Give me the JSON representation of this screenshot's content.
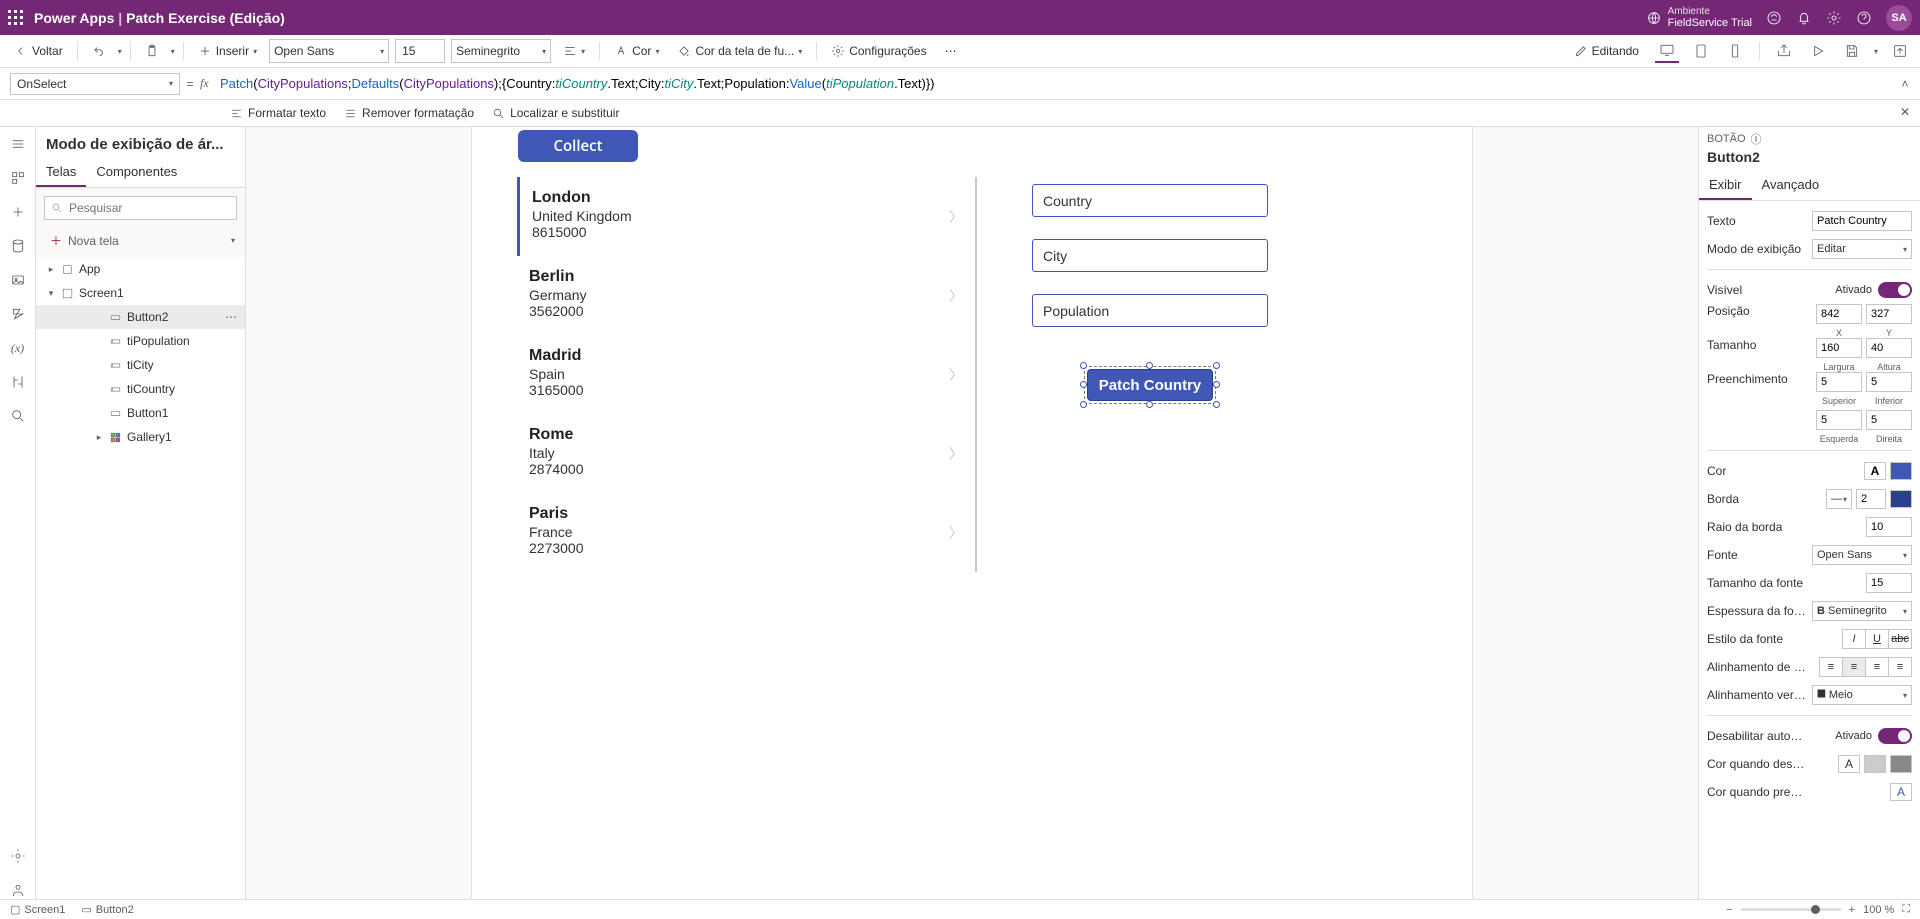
{
  "header": {
    "product": "Power Apps",
    "app_name": "Patch Exercise (Edição)",
    "env_label": "Ambiente",
    "env_name": "FieldService Trial",
    "user_initials": "SA"
  },
  "ribbon": {
    "back": "Voltar",
    "insert": "Inserir",
    "font": "Open Sans",
    "font_size": "15",
    "font_weight": "Seminegrito",
    "color": "Cor",
    "bg_color": "Cor da tela de fu...",
    "settings": "Configurações",
    "editing": "Editando"
  },
  "formula": {
    "property": "OnSelect",
    "tokens": [
      {
        "t": "func",
        "v": "Patch"
      },
      {
        "t": "plain",
        "v": "("
      },
      {
        "t": "ds",
        "v": "CityPopulations"
      },
      {
        "t": "plain",
        "v": ";"
      },
      {
        "t": "func",
        "v": "Defaults"
      },
      {
        "t": "plain",
        "v": "("
      },
      {
        "t": "ds",
        "v": "CityPopulations"
      },
      {
        "t": "plain",
        "v": ");{Country:"
      },
      {
        "t": "var",
        "v": "tiCountry"
      },
      {
        "t": "plain",
        "v": ".Text;City:"
      },
      {
        "t": "var",
        "v": "tiCity"
      },
      {
        "t": "plain",
        "v": ".Text;Population:"
      },
      {
        "t": "func",
        "v": "Value"
      },
      {
        "t": "plain",
        "v": "("
      },
      {
        "t": "var",
        "v": "tiPopulation"
      },
      {
        "t": "plain",
        "v": ".Text)})"
      }
    ],
    "tool_format": "Formatar texto",
    "tool_remove": "Remover formatação",
    "tool_find": "Localizar e substituir"
  },
  "tree": {
    "title": "Modo de exibição de ár...",
    "tab_screens": "Telas",
    "tab_components": "Componentes",
    "search_placeholder": "Pesquisar",
    "new_screen": "Nova tela",
    "app": "App",
    "screen": "Screen1",
    "items": [
      {
        "name": "Button2",
        "type": "button",
        "selected": true
      },
      {
        "name": "tiPopulation",
        "type": "input"
      },
      {
        "name": "tiCity",
        "type": "input"
      },
      {
        "name": "tiCountry",
        "type": "input"
      },
      {
        "name": "Button1",
        "type": "button"
      },
      {
        "name": "Gallery1",
        "type": "gallery",
        "expandable": true
      }
    ]
  },
  "canvas": {
    "collect_label": "Collect",
    "gallery": [
      {
        "city": "London",
        "country": "United Kingdom",
        "pop": "8615000",
        "first": true
      },
      {
        "city": "Berlin",
        "country": "Germany",
        "pop": "3562000"
      },
      {
        "city": "Madrid",
        "country": "Spain",
        "pop": "3165000"
      },
      {
        "city": "Rome",
        "country": "Italy",
        "pop": "2874000"
      },
      {
        "city": "Paris",
        "country": "France",
        "pop": "2273000"
      }
    ],
    "ti_country": "Country",
    "ti_city": "City",
    "ti_population": "Population",
    "patch_label": "Patch Country"
  },
  "props": {
    "breadcrumb_type": "BOTÃO",
    "name": "Button2",
    "tab_display": "Exibir",
    "tab_advanced": "Avançado",
    "text_lbl": "Texto",
    "text_val": "Patch Country",
    "displaymode_lbl": "Modo de exibição",
    "displaymode_val": "Editar",
    "visible_lbl": "Visível",
    "visible_state": "Ativado",
    "position_lbl": "Posição",
    "pos_x": "842",
    "pos_y": "327",
    "pos_x_lbl": "X",
    "pos_y_lbl": "Y",
    "size_lbl": "Tamanho",
    "size_w": "160",
    "size_h": "40",
    "size_w_lbl": "Largura",
    "size_h_lbl": "Altura",
    "padding_lbl": "Preenchimento",
    "pad_t": "5",
    "pad_b": "5",
    "pad_l": "5",
    "pad_r": "5",
    "pad_t_lbl": "Superior",
    "pad_b_lbl": "Inferior",
    "pad_l_lbl": "Esquerda",
    "pad_r_lbl": "Direita",
    "color_lbl": "Cor",
    "border_lbl": "Borda",
    "border_val": "2",
    "radius_lbl": "Raio da borda",
    "radius_val": "10",
    "font_lbl": "Fonte",
    "font_val": "Open Sans",
    "fontsize_lbl": "Tamanho da fonte",
    "fontsize_val": "15",
    "fontweight_lbl": "Espessura da fonte",
    "fontweight_val": "Seminegrito",
    "fontstyle_lbl": "Estilo da fonte",
    "textalign_lbl": "Alinhamento de texto",
    "valign_lbl": "Alinhamento vertical",
    "valign_val": "Meio",
    "autodisable_lbl": "Desabilitar automati...",
    "autodisable_state": "Ativado",
    "disabledcolor_lbl": "Cor quando desabili...",
    "pressedcolor_lbl": "Cor quando pressio..."
  },
  "statusbar": {
    "crumb1": "Screen1",
    "crumb2": "Button2",
    "zoom": "100 %"
  }
}
